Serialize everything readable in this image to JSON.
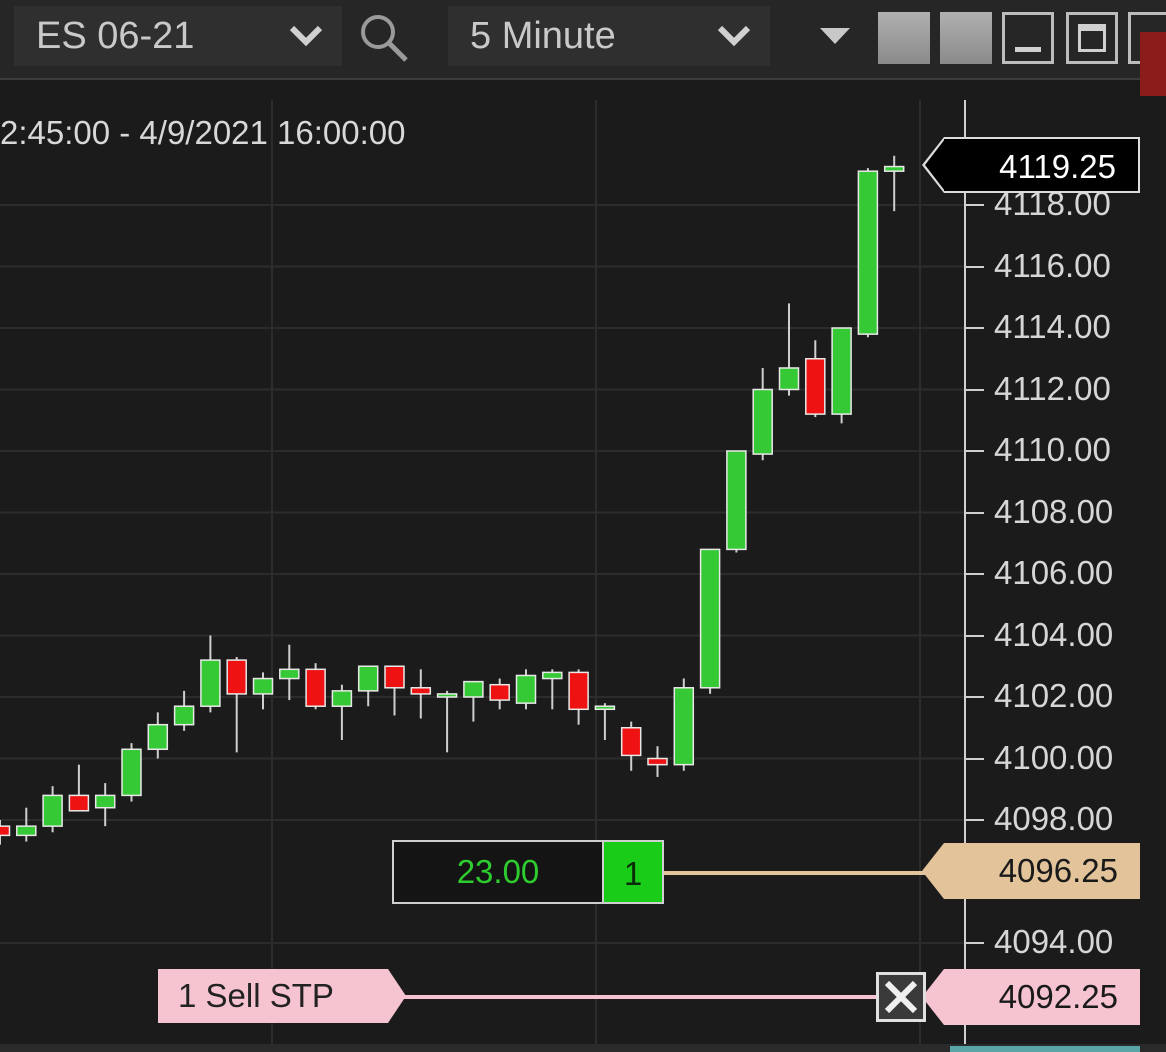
{
  "toolbar": {
    "instrument": "ES 06-21",
    "interval": "5 Minute",
    "icons": {
      "search": "search-icon",
      "instrument_chevron": "chevron-down-icon",
      "interval_chevron": "chevron-down-icon",
      "menu": "caret-down-icon",
      "minimize": "minimize-icon",
      "maximize": "maximize-icon"
    }
  },
  "chart": {
    "date_range": "2:45:00 - 4/9/2021 16:00:00",
    "colors": {
      "background": "#1b1b1b",
      "grid": "#2c2c2c",
      "up": "#35c935",
      "down": "#ee1212",
      "wick": "#cfcfcf",
      "position_line": "#e2c39a",
      "stop_line": "#f6c3d0"
    }
  },
  "chart_data": {
    "type": "candlestick",
    "ylim": [
      4091,
      4121
    ],
    "y_ticks": [
      "4118.00",
      "4116.00",
      "4114.00",
      "4112.00",
      "4110.00",
      "4108.00",
      "4106.00",
      "4104.00",
      "4102.00",
      "4100.00",
      "4098.00",
      "4094.00"
    ],
    "candles": [
      {
        "o": 4097.8,
        "h": 4098.0,
        "l": 4097.2,
        "c": 4097.5
      },
      {
        "o": 4097.5,
        "h": 4098.4,
        "l": 4097.3,
        "c": 4097.8
      },
      {
        "o": 4097.8,
        "h": 4099.1,
        "l": 4097.6,
        "c": 4098.8
      },
      {
        "o": 4098.8,
        "h": 4099.8,
        "l": 4098.3,
        "c": 4098.3
      },
      {
        "o": 4098.4,
        "h": 4099.2,
        "l": 4097.8,
        "c": 4098.8
      },
      {
        "o": 4098.8,
        "h": 4100.5,
        "l": 4098.6,
        "c": 4100.3
      },
      {
        "o": 4100.3,
        "h": 4101.5,
        "l": 4100.0,
        "c": 4101.1
      },
      {
        "o": 4101.1,
        "h": 4102.2,
        "l": 4100.9,
        "c": 4101.7
      },
      {
        "o": 4101.7,
        "h": 4104.0,
        "l": 4101.5,
        "c": 4103.2
      },
      {
        "o": 4103.2,
        "h": 4103.3,
        "l": 4100.2,
        "c": 4102.1
      },
      {
        "o": 4102.1,
        "h": 4102.8,
        "l": 4101.6,
        "c": 4102.6
      },
      {
        "o": 4102.6,
        "h": 4103.7,
        "l": 4101.9,
        "c": 4102.9
      },
      {
        "o": 4102.9,
        "h": 4103.1,
        "l": 4101.6,
        "c": 4101.7
      },
      {
        "o": 4101.7,
        "h": 4102.4,
        "l": 4100.6,
        "c": 4102.2
      },
      {
        "o": 4102.2,
        "h": 4103.0,
        "l": 4101.7,
        "c": 4103.0
      },
      {
        "o": 4103.0,
        "h": 4103.0,
        "l": 4101.4,
        "c": 4102.3
      },
      {
        "o": 4102.3,
        "h": 4102.9,
        "l": 4101.3,
        "c": 4102.1
      },
      {
        "o": 4102.0,
        "h": 4102.2,
        "l": 4100.2,
        "c": 4102.1
      },
      {
        "o": 4102.0,
        "h": 4102.5,
        "l": 4101.2,
        "c": 4102.5
      },
      {
        "o": 4102.4,
        "h": 4102.6,
        "l": 4101.6,
        "c": 4101.9
      },
      {
        "o": 4101.8,
        "h": 4102.9,
        "l": 4101.6,
        "c": 4102.7
      },
      {
        "o": 4102.6,
        "h": 4102.9,
        "l": 4101.6,
        "c": 4102.8
      },
      {
        "o": 4102.8,
        "h": 4102.9,
        "l": 4101.1,
        "c": 4101.6
      },
      {
        "o": 4101.6,
        "h": 4101.8,
        "l": 4100.6,
        "c": 4101.7
      },
      {
        "o": 4101.0,
        "h": 4101.2,
        "l": 4099.6,
        "c": 4100.1
      },
      {
        "o": 4100.0,
        "h": 4100.4,
        "l": 4099.4,
        "c": 4099.8
      },
      {
        "o": 4099.8,
        "h": 4102.6,
        "l": 4099.6,
        "c": 4102.3
      },
      {
        "o": 4102.3,
        "h": 4106.8,
        "l": 4102.1,
        "c": 4106.8
      },
      {
        "o": 4106.8,
        "h": 4110.0,
        "l": 4106.7,
        "c": 4110.0
      },
      {
        "o": 4109.9,
        "h": 4112.7,
        "l": 4109.7,
        "c": 4112.0
      },
      {
        "o": 4112.0,
        "h": 4114.8,
        "l": 4111.8,
        "c": 4112.7
      },
      {
        "o": 4113.0,
        "h": 4113.6,
        "l": 4111.1,
        "c": 4111.2
      },
      {
        "o": 4111.2,
        "h": 4114.0,
        "l": 4110.9,
        "c": 4114.0
      },
      {
        "o": 4113.8,
        "h": 4119.2,
        "l": 4113.7,
        "c": 4119.1
      },
      {
        "o": 4119.1,
        "h": 4119.6,
        "l": 4117.8,
        "c": 4119.25
      }
    ]
  },
  "price_flags": {
    "last_price": "4119.25",
    "position_price": "4096.25",
    "stop_price": "4092.25"
  },
  "position": {
    "pnl": "23.00",
    "quantity": "1"
  },
  "order": {
    "label": "1  Sell STP"
  }
}
